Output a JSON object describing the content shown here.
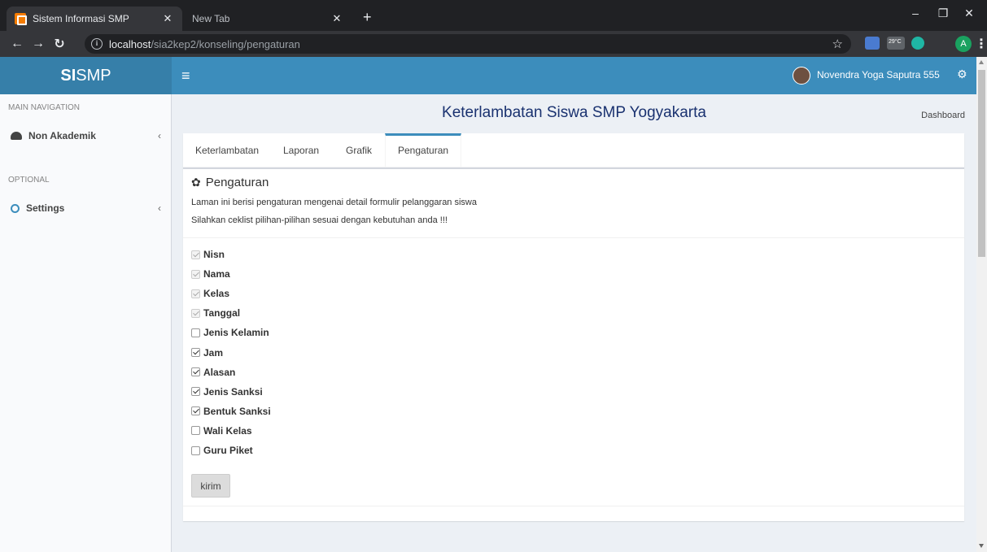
{
  "browser": {
    "active_tab_title": "Sistem Informasi SMP",
    "inactive_tab_title": "New Tab",
    "url_host": "localhost",
    "url_path": "/sia2kep2/konseling/pengaturan",
    "weather": "29°C",
    "profile_initial": "A"
  },
  "header": {
    "logo_bold": "SI",
    "logo_rest": "SMP",
    "user_name": "Novendra Yoga Saputra 555"
  },
  "sidebar": {
    "main_header": "MAIN NAVIGATION",
    "optional_header": "OPTIONAL",
    "items": [
      {
        "label": "Non Akademik"
      },
      {
        "label": "Settings"
      }
    ]
  },
  "content": {
    "page_title": "Keterlambatan Siswa SMP Yogyakarta",
    "breadcrumb": "Dashboard",
    "tabs": [
      {
        "label": "Keterlambatan",
        "active": false
      },
      {
        "label": "Laporan",
        "active": false
      },
      {
        "label": "Grafik",
        "active": false
      },
      {
        "label": "Pengaturan",
        "active": true
      }
    ],
    "section_title": "Pengaturan",
    "description_1": "Laman ini berisi pengaturan mengenai detail formulir pelanggaran siswa",
    "description_2": "Silahkan ceklist pilihan-pilihan sesuai dengan kebutuhan anda !!!",
    "options": [
      {
        "label": "Nisn",
        "checked": true,
        "disabled": true
      },
      {
        "label": "Nama",
        "checked": true,
        "disabled": true
      },
      {
        "label": "Kelas",
        "checked": true,
        "disabled": true
      },
      {
        "label": "Tanggal",
        "checked": true,
        "disabled": true
      },
      {
        "label": "Jenis Kelamin",
        "checked": false,
        "disabled": false
      },
      {
        "label": "Jam",
        "checked": true,
        "disabled": false
      },
      {
        "label": "Alasan",
        "checked": true,
        "disabled": false
      },
      {
        "label": "Jenis Sanksi",
        "checked": true,
        "disabled": false
      },
      {
        "label": "Bentuk Sanksi",
        "checked": true,
        "disabled": false
      },
      {
        "label": "Wali Kelas",
        "checked": false,
        "disabled": false
      },
      {
        "label": "Guru Piket",
        "checked": false,
        "disabled": false
      }
    ],
    "submit_label": "kirim"
  },
  "colors": {
    "navbar": "#3c8dbc",
    "logo_bg": "#367fa9",
    "title_color": "#1a3270"
  }
}
